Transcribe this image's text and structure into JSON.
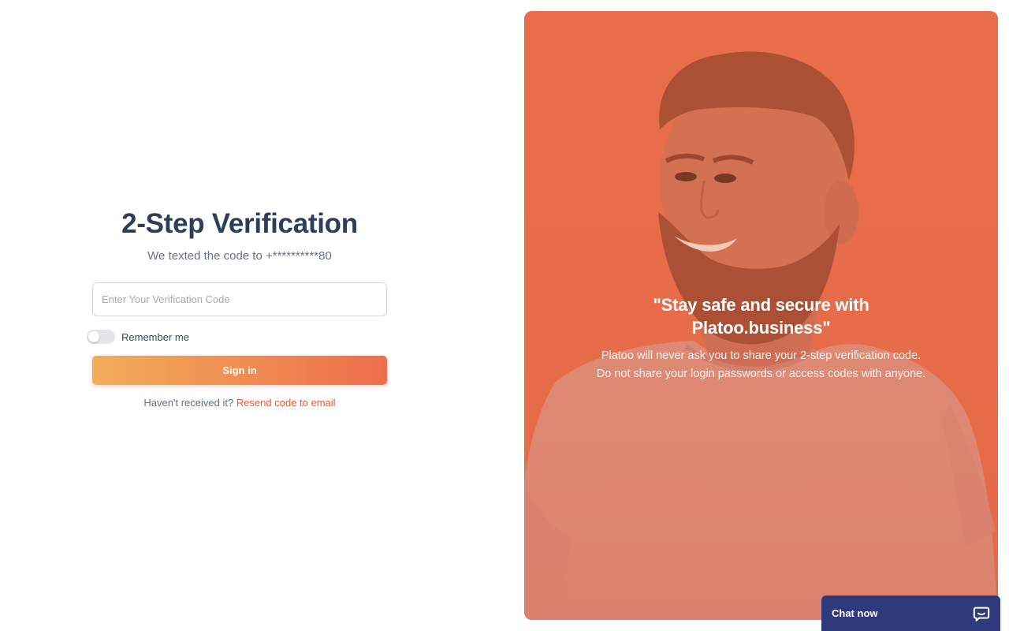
{
  "login": {
    "title": "2-Step Verification",
    "subtitle": "We texted the code to +**********80",
    "code_placeholder": "Enter Your Verification Code",
    "remember_label": "Remember me",
    "remember_on": false,
    "signin_label": "Sign in",
    "resend_prompt": "Haven't received it?",
    "resend_link": "Resend code to email"
  },
  "promo": {
    "quote_line1": "\"Stay safe and secure with",
    "quote_line2": "Platoo.business\"",
    "info_line1": "Platoo will never ask you to share your 2-step verification code.",
    "info_line2": "Do not share your login passwords or access codes with anyone.",
    "image_icon": "smiling-bearded-man-photo"
  },
  "chat": {
    "label": "Chat now",
    "icon": "chat-bubble-icon"
  },
  "colors": {
    "accent": "#ee5a2f",
    "title": "#2d3e5c",
    "gradient_start": "#f2ad5a",
    "gradient_end": "#ee6e4b",
    "chat_bg": "#2f3a7c",
    "promo_bg": "#e8704f"
  }
}
